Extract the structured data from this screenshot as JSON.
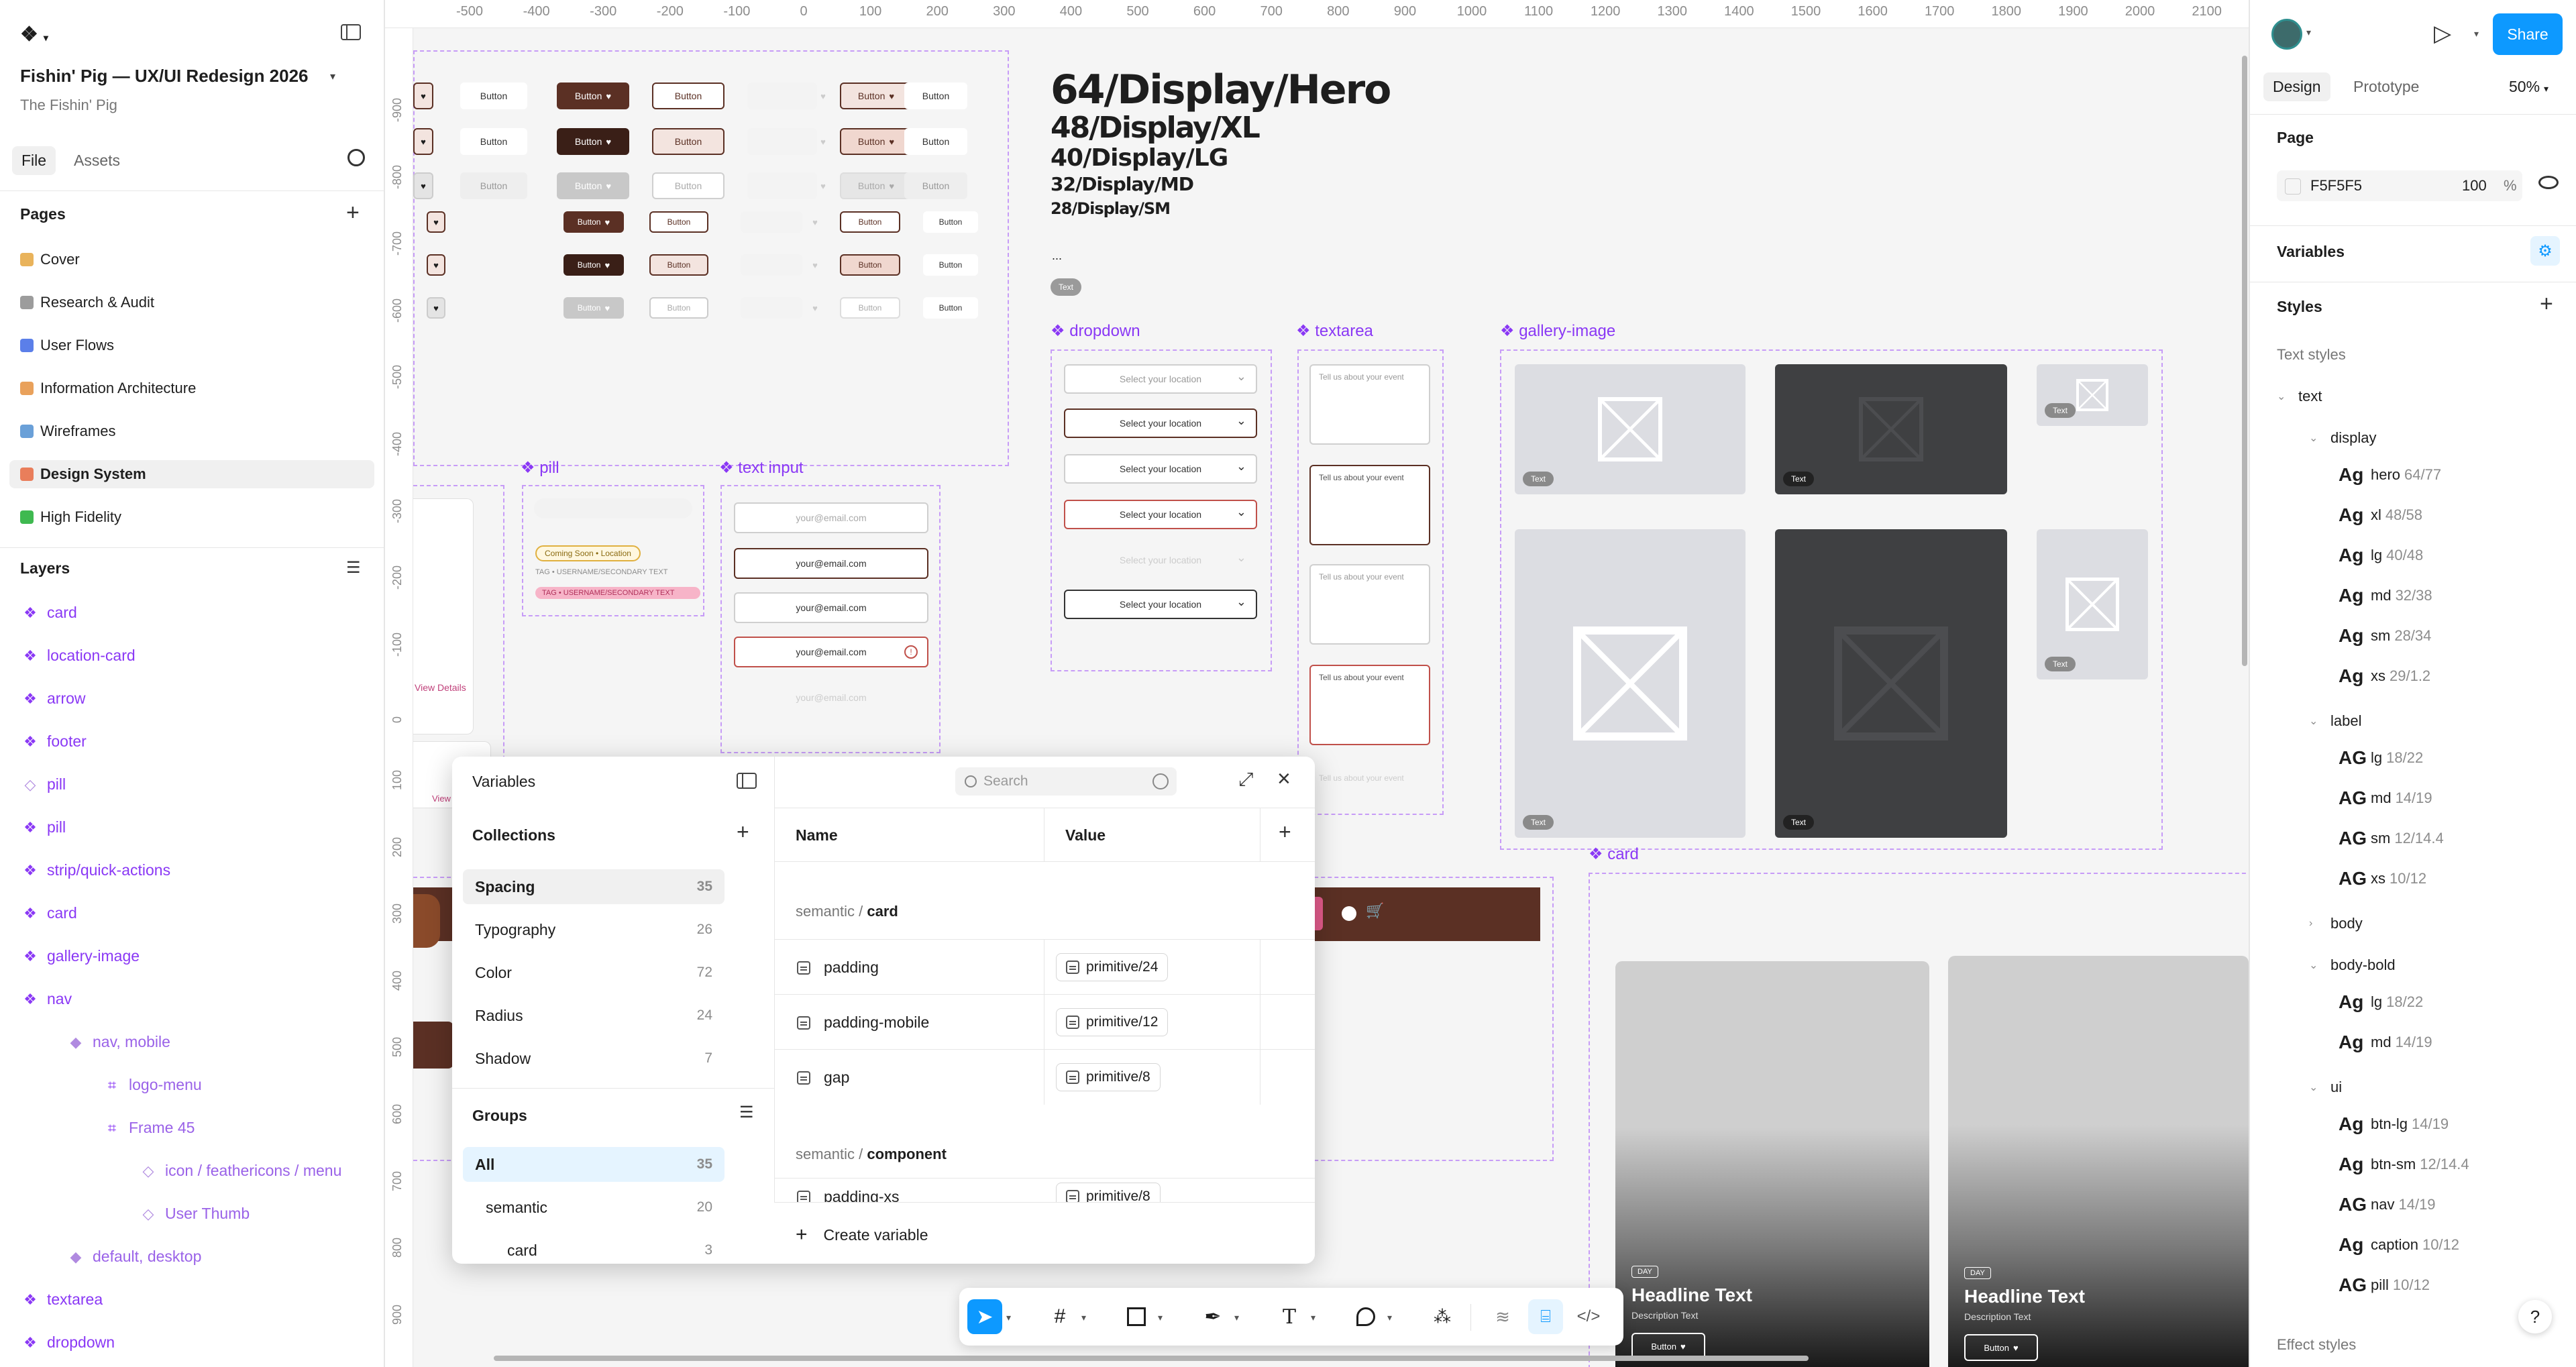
{
  "file": {
    "title": "Fishin' Pig — UX/UI Redesign 2026",
    "team": "The Fishin' Pig",
    "tabs": [
      "File",
      "Assets"
    ]
  },
  "pages": {
    "heading": "Pages",
    "items": [
      {
        "label": "Cover",
        "color": "#e9b35b"
      },
      {
        "label": "Research & Audit",
        "color": "#9c9c9c"
      },
      {
        "label": "User Flows",
        "color": "#5b7fe9"
      },
      {
        "label": "Information Architecture",
        "color": "#e9a15b"
      },
      {
        "label": "Wireframes",
        "color": "#6aa0d8"
      },
      {
        "label": "Design System",
        "color": "#e97e5b"
      },
      {
        "label": "High Fidelity",
        "color": "#3fb950"
      }
    ],
    "active_index": 5
  },
  "layers": {
    "heading": "Layers",
    "items": [
      {
        "label": "card",
        "indent": 0,
        "icon": "component"
      },
      {
        "label": "location-card",
        "indent": 0,
        "icon": "component"
      },
      {
        "label": "arrow",
        "indent": 0,
        "icon": "component"
      },
      {
        "label": "footer",
        "indent": 0,
        "icon": "component"
      },
      {
        "label": "pill",
        "indent": 0,
        "icon": "instance"
      },
      {
        "label": "pill",
        "indent": 0,
        "icon": "component"
      },
      {
        "label": "strip/quick-actions",
        "indent": 0,
        "icon": "component"
      },
      {
        "label": "card",
        "indent": 0,
        "icon": "component"
      },
      {
        "label": "gallery-image",
        "indent": 0,
        "icon": "component"
      },
      {
        "label": "nav",
        "indent": 0,
        "icon": "component"
      },
      {
        "label": "nav, mobile",
        "indent": 1,
        "icon": "variant"
      },
      {
        "label": "logo-menu",
        "indent": 2,
        "icon": "frame"
      },
      {
        "label": "Frame 45",
        "indent": 2,
        "icon": "frame"
      },
      {
        "label": "icon / feathericons / menu",
        "indent": 3,
        "icon": "instance"
      },
      {
        "label": "User Thumb",
        "indent": 3,
        "icon": "instance"
      },
      {
        "label": "default, desktop",
        "indent": 1,
        "icon": "variant"
      },
      {
        "label": "textarea",
        "indent": 0,
        "icon": "component"
      },
      {
        "label": "dropdown",
        "indent": 0,
        "icon": "component"
      }
    ]
  },
  "ruler": {
    "x_ticks": [
      "-500",
      "-400",
      "-300",
      "-200",
      "-100",
      "0",
      "100",
      "200",
      "300",
      "400",
      "500",
      "600",
      "700",
      "800",
      "900",
      "1000",
      "1100",
      "1200",
      "1300",
      "1400",
      "1500",
      "1600",
      "1700",
      "1800",
      "1900",
      "2000",
      "2100"
    ],
    "y_ticks": [
      "-900",
      "-800",
      "-700",
      "-600",
      "-500",
      "-400",
      "-300",
      "-200",
      "-100",
      "0",
      "100",
      "200",
      "300",
      "400",
      "500",
      "600",
      "700",
      "800",
      "900"
    ]
  },
  "canvas": {
    "display_styles": [
      "64/Display/Hero",
      "48/Display/XL",
      "40/Display/LG",
      "32/Display/MD",
      "28/Display/SM"
    ],
    "ellipsis": "...",
    "text_tag": "Text",
    "button_label": "Button",
    "frames": {
      "pill": "pill",
      "text_input": "text input",
      "dropdown": "dropdown",
      "textarea": "textarea",
      "gallery_image": "gallery-image",
      "card": "card"
    },
    "pill_items": [
      "Coming Soon • Location",
      "TAG • USERNAME/SECONDARY TEXT",
      "TAG • USERNAME/SECONDARY TEXT"
    ],
    "input_placeholder": "your@email.com",
    "dropdown_placeholder": "Select your location",
    "textarea_placeholder": "Tell us about your event",
    "view_details": "View Details",
    "view_short": "View",
    "card_day": "DAY",
    "card_headline": "Headline Text",
    "card_description": "Description Text",
    "brand_brown": "#5b3024"
  },
  "variables_modal": {
    "title": "Variables",
    "search_placeholder": "Search",
    "collections_heading": "Collections",
    "collections": [
      {
        "label": "Spacing",
        "count": "35"
      },
      {
        "label": "Typography",
        "count": "26"
      },
      {
        "label": "Color",
        "count": "72"
      },
      {
        "label": "Radius",
        "count": "24"
      },
      {
        "label": "Shadow",
        "count": "7"
      }
    ],
    "groups_heading": "Groups",
    "groups": [
      {
        "label": "All",
        "count": "35"
      },
      {
        "label": "semantic",
        "count": "20"
      },
      {
        "label": "card",
        "count": "3"
      }
    ],
    "col_name": "Name",
    "col_value": "Value",
    "section_card": {
      "prefix": "semantic / ",
      "name": "card"
    },
    "rows": [
      {
        "name": "padding",
        "value": "primitive/24"
      },
      {
        "name": "padding-mobile",
        "value": "primitive/12"
      },
      {
        "name": "gap",
        "value": "primitive/8"
      }
    ],
    "section_component": {
      "prefix": "semantic / ",
      "name": "component"
    },
    "partial_row": {
      "name": "padding-xs",
      "value": "primitive/8"
    },
    "create_label": "Create variable"
  },
  "right_panel": {
    "tabs": [
      "Design",
      "Prototype"
    ],
    "zoom": "50%",
    "share_label": "Share",
    "page_heading": "Page",
    "page_fill": "F5F5F5",
    "page_opacity": "100",
    "percent": "%",
    "variables_heading": "Variables",
    "styles_heading": "Styles",
    "text_styles_heading": "Text styles",
    "effect_styles_heading": "Effect styles",
    "ag": "Ag",
    "ag_caps": "AG",
    "tree": [
      {
        "type": "group",
        "label": "text",
        "level": 0,
        "open": true
      },
      {
        "type": "group",
        "label": "display",
        "level": 1,
        "open": true
      },
      {
        "type": "style",
        "name": "hero",
        "size": "64/77",
        "caps": false
      },
      {
        "type": "style",
        "name": "xl",
        "size": "48/58",
        "caps": false
      },
      {
        "type": "style",
        "name": "lg",
        "size": "40/48",
        "caps": false
      },
      {
        "type": "style",
        "name": "md",
        "size": "32/38",
        "caps": false
      },
      {
        "type": "style",
        "name": "sm",
        "size": "28/34",
        "caps": false
      },
      {
        "type": "style",
        "name": "xs",
        "size": "29/1.2",
        "caps": false
      },
      {
        "type": "group",
        "label": "label",
        "level": 1,
        "open": true
      },
      {
        "type": "style",
        "name": "lg",
        "size": "18/22",
        "caps": true
      },
      {
        "type": "style",
        "name": "md",
        "size": "14/19",
        "caps": true
      },
      {
        "type": "style",
        "name": "sm",
        "size": "12/14.4",
        "caps": true
      },
      {
        "type": "style",
        "name": "xs",
        "size": "10/12",
        "caps": true
      },
      {
        "type": "group",
        "label": "body",
        "level": 1,
        "open": false
      },
      {
        "type": "group",
        "label": "body-bold",
        "level": 1,
        "open": true
      },
      {
        "type": "style",
        "name": "lg",
        "size": "18/22",
        "caps": false
      },
      {
        "type": "style",
        "name": "md",
        "size": "14/19",
        "caps": false
      },
      {
        "type": "group",
        "label": "ui",
        "level": 1,
        "open": true
      },
      {
        "type": "style",
        "name": "btn-lg",
        "size": "14/19",
        "caps": false
      },
      {
        "type": "style",
        "name": "btn-sm",
        "size": "12/14.4",
        "caps": false
      },
      {
        "type": "style",
        "name": "nav",
        "size": "14/19",
        "caps": true
      },
      {
        "type": "style",
        "name": "caption",
        "size": "10/12",
        "caps": false
      },
      {
        "type": "style",
        "name": "pill",
        "size": "10/12",
        "caps": true
      }
    ],
    "help": "?"
  },
  "colors": {
    "accent": "#0d99ff",
    "purple": "#8a38f5",
    "brown": "#5b3024",
    "dark_brown": "#3a1f17"
  }
}
